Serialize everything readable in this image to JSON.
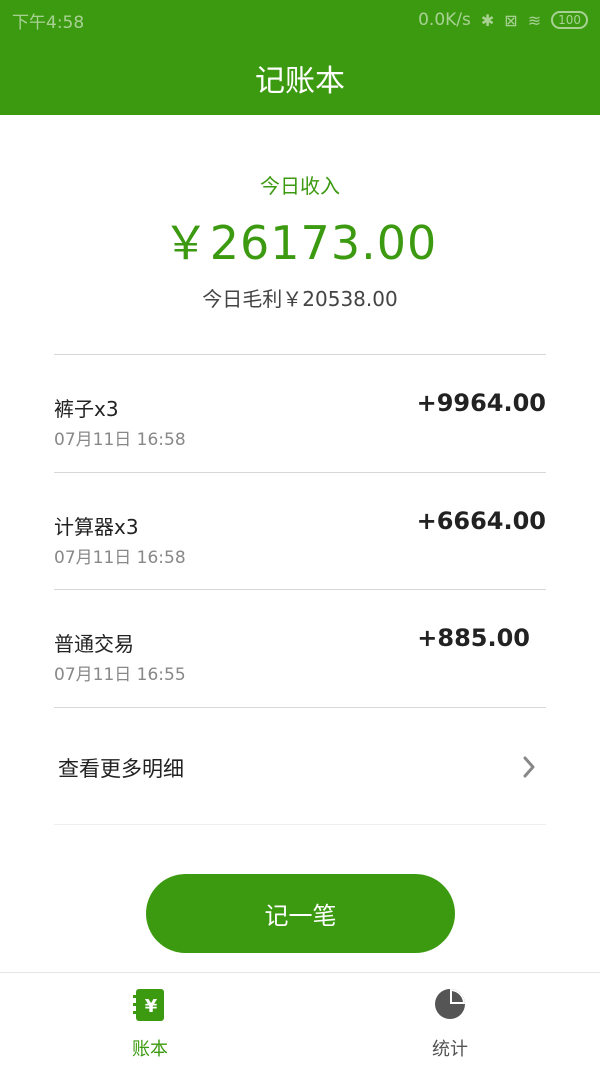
{
  "status_bar": {
    "time": "下午4:58",
    "network_speed": "0.0K/s",
    "battery": "100"
  },
  "app_bar": {
    "title": "记账本"
  },
  "summary": {
    "income_label": "今日收入",
    "income_value": "￥26173.00",
    "profit_text": "今日毛利￥20538.00"
  },
  "transactions": [
    {
      "title": "裤子x3",
      "time": "07月11日 16:58",
      "amount": "+9964.00"
    },
    {
      "title": "计算器x3",
      "time": "07月11日 16:58",
      "amount": "+6664.00"
    },
    {
      "title": "普通交易",
      "time": "07月11日 16:55",
      "amount": "+885.00"
    }
  ],
  "more_details": {
    "label": "查看更多明细"
  },
  "record_button": {
    "label": "记一笔"
  },
  "bottom_nav": {
    "items": [
      {
        "label": "账本",
        "icon": "ledger-icon",
        "active": true
      },
      {
        "label": "统计",
        "icon": "pie-chart-icon",
        "active": false
      }
    ]
  },
  "colors": {
    "accent": "#3c9a10",
    "inactive": "#555555"
  }
}
